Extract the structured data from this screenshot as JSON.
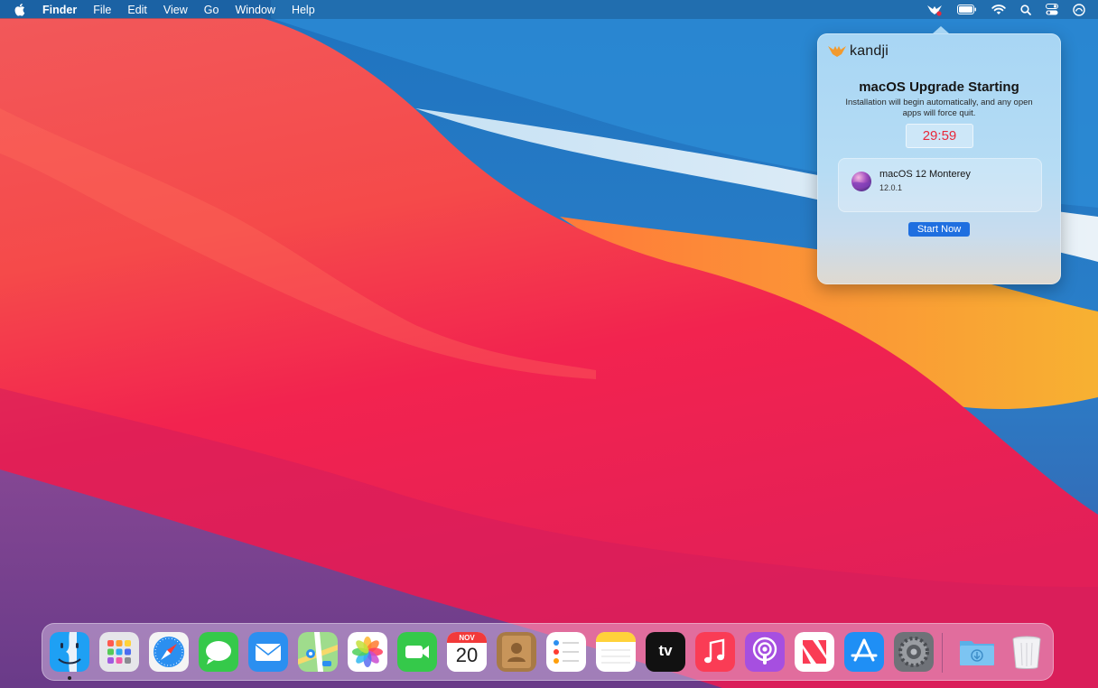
{
  "menubar": {
    "apple_icon": "apple-logo-icon",
    "app_name": "Finder",
    "menus": [
      "File",
      "Edit",
      "View",
      "Go",
      "Window",
      "Help"
    ],
    "status_icons": [
      "kandji-bird-icon",
      "battery-icon",
      "wifi-icon",
      "spotlight-search-icon",
      "control-center-icon",
      "siri-icon"
    ]
  },
  "popover": {
    "brand": "kandji",
    "title": "macOS Upgrade Starting",
    "subtitle": "Installation will begin automatically, and any open apps will force quit.",
    "countdown": "29:59",
    "update": {
      "name": "macOS 12 Monterey",
      "version": "12.0.1"
    },
    "start_button": "Start Now",
    "colors": {
      "accent": "#1f6fe0",
      "countdown": "#e8293b",
      "brand_logo": "#f29a2e"
    }
  },
  "dock": {
    "apps": [
      {
        "name": "Finder",
        "icon": "finder-icon",
        "running": true
      },
      {
        "name": "Launchpad",
        "icon": "launchpad-icon"
      },
      {
        "name": "Safari",
        "icon": "safari-icon"
      },
      {
        "name": "Messages",
        "icon": "messages-icon"
      },
      {
        "name": "Mail",
        "icon": "mail-icon"
      },
      {
        "name": "Maps",
        "icon": "maps-icon"
      },
      {
        "name": "Photos",
        "icon": "photos-icon"
      },
      {
        "name": "FaceTime",
        "icon": "facetime-icon"
      },
      {
        "name": "Calendar",
        "icon": "calendar-icon",
        "month": "NOV",
        "day": "20"
      },
      {
        "name": "Contacts",
        "icon": "contacts-icon"
      },
      {
        "name": "Reminders",
        "icon": "reminders-icon"
      },
      {
        "name": "Notes",
        "icon": "notes-icon"
      },
      {
        "name": "TV",
        "icon": "apple-tv-icon",
        "label": "tv"
      },
      {
        "name": "Music",
        "icon": "music-icon"
      },
      {
        "name": "Podcasts",
        "icon": "podcasts-icon"
      },
      {
        "name": "News",
        "icon": "news-icon"
      },
      {
        "name": "App Store",
        "icon": "app-store-icon"
      },
      {
        "name": "System Preferences",
        "icon": "system-preferences-icon"
      },
      {
        "name": "Downloads",
        "icon": "downloads-folder-icon"
      },
      {
        "name": "Trash",
        "icon": "trash-icon"
      }
    ]
  }
}
